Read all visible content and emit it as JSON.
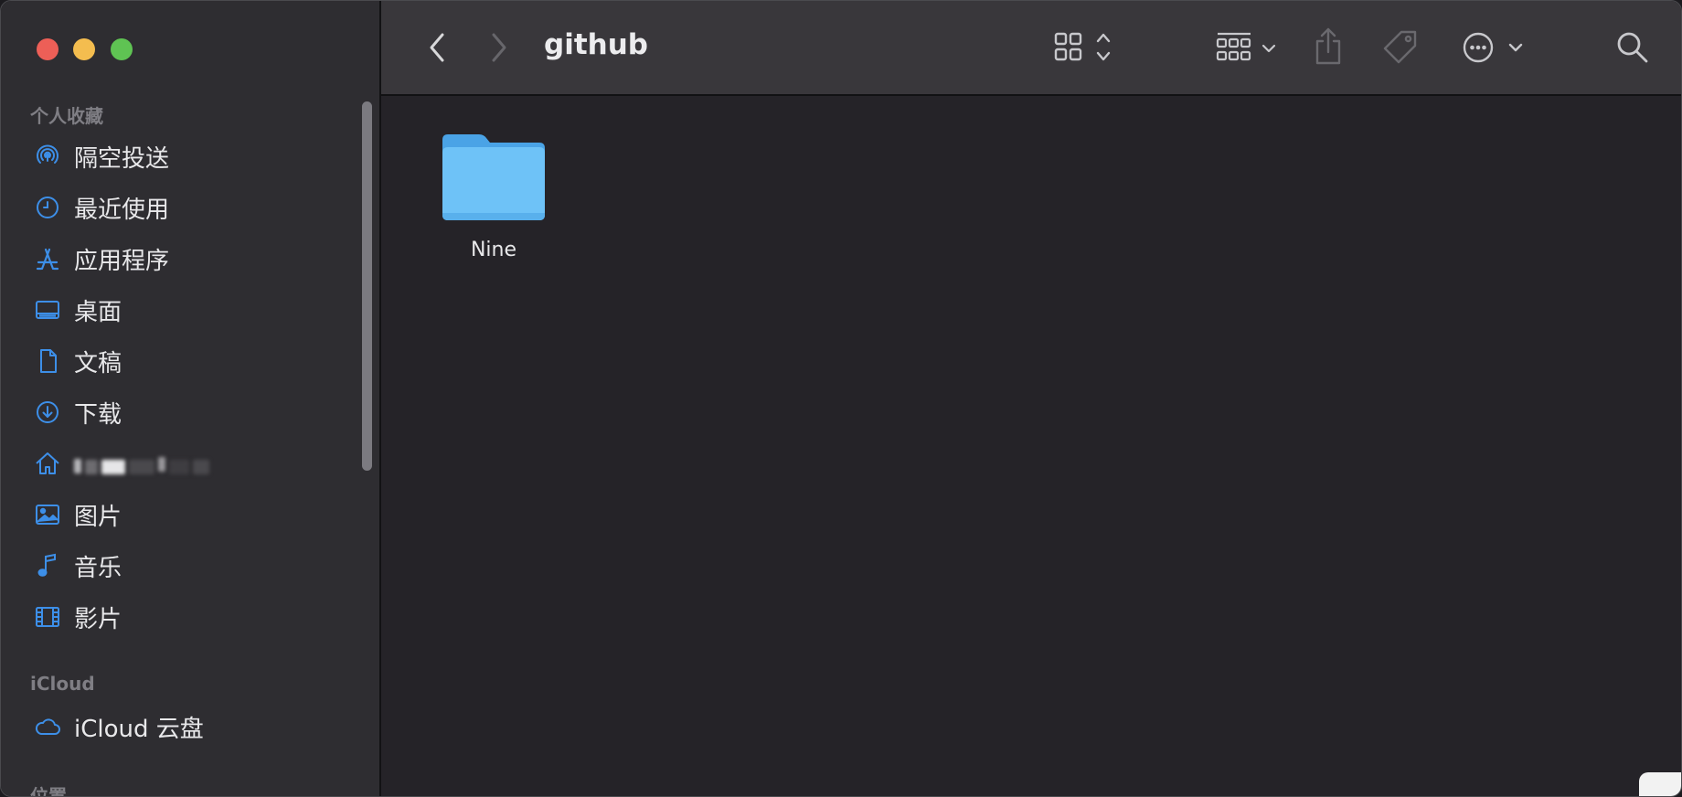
{
  "window": {
    "title": "github"
  },
  "sidebar": {
    "favorites_title": "个人收藏",
    "favorites": [
      {
        "label": "隔空投送",
        "icon": "airdrop-icon"
      },
      {
        "label": "最近使用",
        "icon": "clock-icon"
      },
      {
        "label": "应用程序",
        "icon": "applications-icon"
      },
      {
        "label": "桌面",
        "icon": "desktop-icon"
      },
      {
        "label": "文稿",
        "icon": "document-icon"
      },
      {
        "label": "下载",
        "icon": "download-icon"
      },
      {
        "label": "",
        "icon": "home-icon"
      },
      {
        "label": "图片",
        "icon": "pictures-icon"
      },
      {
        "label": "音乐",
        "icon": "music-icon"
      },
      {
        "label": "影片",
        "icon": "movies-icon"
      }
    ],
    "icloud_title": "iCloud",
    "icloud": [
      {
        "label": "iCloud 云盘",
        "icon": "cloud-icon"
      }
    ],
    "locations_title": "位置"
  },
  "content": {
    "items": [
      {
        "name": "Nine",
        "kind": "folder"
      }
    ]
  },
  "colors": {
    "accent": "#3d8fe8",
    "folder": "#6ec2f7",
    "close": "#ed5f57",
    "minimize": "#f4bd4f",
    "zoom": "#5fc353"
  }
}
